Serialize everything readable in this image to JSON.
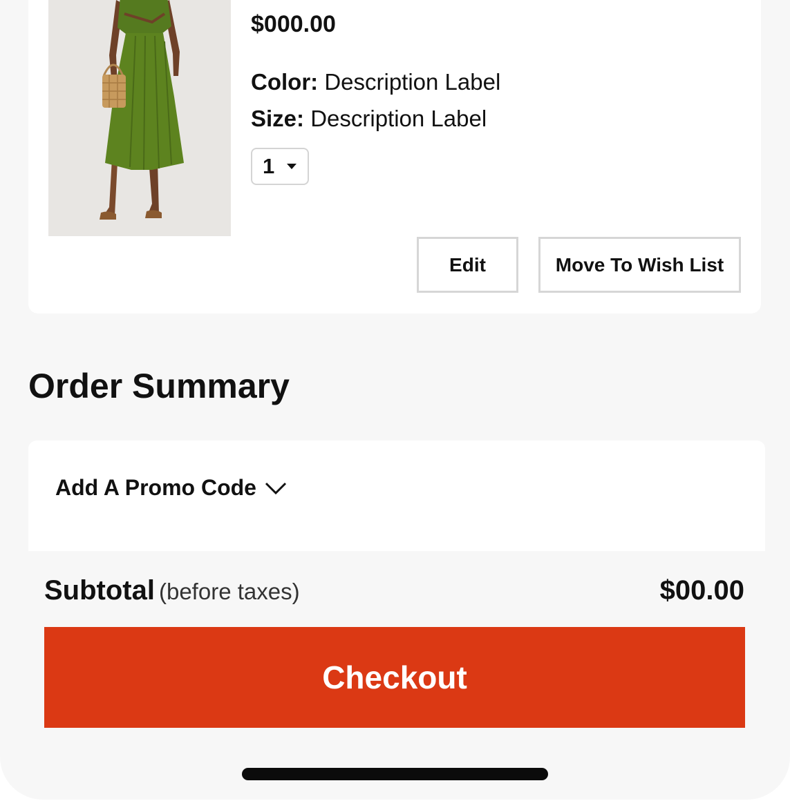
{
  "cart_item": {
    "image_alt": "Green midi dress with woven handbag",
    "price": "$000.00",
    "color_key": "Color:",
    "color_value": "Description Label",
    "size_key": "Size:",
    "size_value": "Description Label",
    "quantity": "1",
    "edit_label": "Edit",
    "wishlist_label": "Move To Wish List"
  },
  "order_summary": {
    "title": "Order Summary",
    "promo_label": "Add A Promo Code",
    "subtotal_label": "Subtotal",
    "subtotal_note": "(before taxes)",
    "subtotal_value": "$00.00",
    "checkout_label": "Checkout"
  },
  "colors": {
    "checkout": "#db3914",
    "page_background": "#f7f7f7",
    "card_background": "#ffffff"
  },
  "icons": {
    "quantity_dropdown": "caret-down-icon",
    "promo_toggle": "chevron-down-icon"
  }
}
